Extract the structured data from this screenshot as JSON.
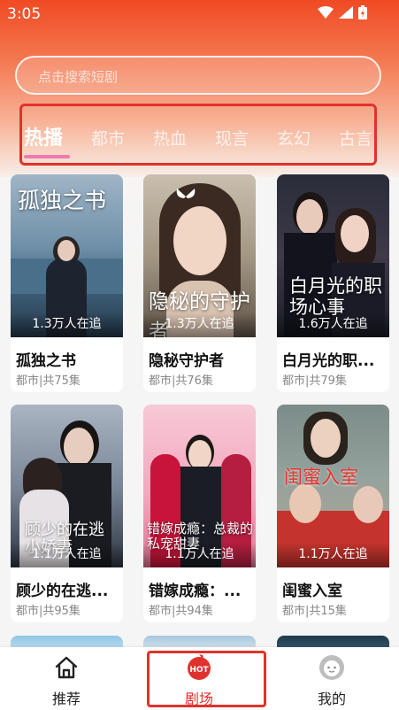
{
  "status": {
    "time": "3:05"
  },
  "search": {
    "placeholder": "点击搜索短剧"
  },
  "tabs": [
    "热播",
    "都市",
    "热血",
    "现言",
    "玄幻",
    "古言"
  ],
  "dramas": [
    {
      "cover_title": "孤独之书",
      "watching": "1.3万人在追",
      "name": "孤独之书",
      "meta": "都市|共75集"
    },
    {
      "cover_title": "隐秘的守护者",
      "watching": "1.3万人在追",
      "name": "隐秘守护者",
      "meta": "都市|共76集"
    },
    {
      "cover_title": "白月光的职场心事",
      "watching": "1.6万人在追",
      "name": "白月光的职...",
      "meta": "都市|共79集"
    },
    {
      "cover_title": "顾少的在逃小娇妻",
      "watching": "1.1万人在追",
      "name": "顾少的在逃...",
      "meta": "都市|共95集"
    },
    {
      "cover_title": "错嫁成瘾：总裁的私宠甜妻",
      "watching": "1.1万人在追",
      "name": "错嫁成瘾：...",
      "meta": "都市|共94集"
    },
    {
      "cover_title": "闺蜜入室",
      "watching": "1.1万人在追",
      "name": "闺蜜入室",
      "meta": "都市|共15集"
    }
  ],
  "nav": [
    {
      "label": "推荐",
      "icon": "home-icon"
    },
    {
      "label": "剧场",
      "icon": "hot-icon",
      "badge": "HOT"
    },
    {
      "label": "我的",
      "icon": "profile-icon"
    }
  ],
  "colors": {
    "accent": "#e0322c",
    "header_top": "#f04a23",
    "tab_underline": "#f07bb2"
  }
}
